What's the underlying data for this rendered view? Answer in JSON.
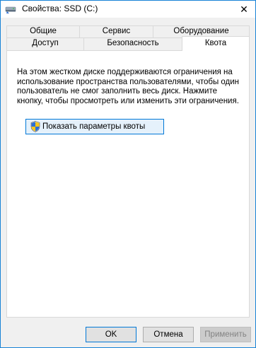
{
  "window": {
    "title": "Свойства: SSD (C:)",
    "title_icon": "drive-icon",
    "close_glyph": "✕"
  },
  "tabs": {
    "row1": [
      "Общие",
      "Сервис",
      "Оборудование"
    ],
    "row2": [
      "Доступ",
      "Безопасность",
      "Квота"
    ],
    "active": "Квота"
  },
  "quota_page": {
    "description": "На этом жестком диске поддерживаются ограничения на использование пространства пользователями, чтобы один пользователь не смог заполнить весь диск. Нажмите кнопку, чтобы просмотреть или изменить эти ограничения.",
    "show_settings_button": "Показать параметры квоты",
    "button_icon": "uac-shield-icon"
  },
  "footer": {
    "ok": "OK",
    "cancel": "Отмена",
    "apply": "Применить",
    "apply_disabled": true
  },
  "colors": {
    "accent_border": "#1883d7",
    "button_focus": "#0078d7"
  }
}
